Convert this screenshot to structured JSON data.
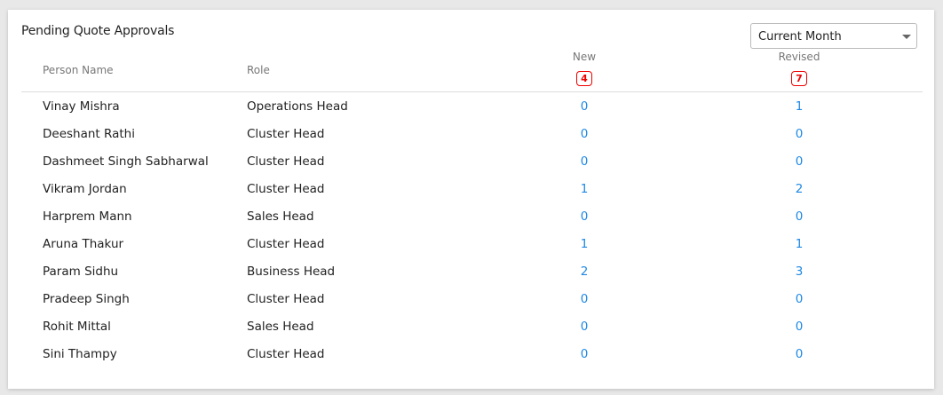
{
  "title": "Pending Quote Approvals",
  "filter": {
    "selected": "Current Month"
  },
  "columns": {
    "person": "Person Name",
    "role": "Role",
    "new": "New",
    "revised": "Revised"
  },
  "totals": {
    "new": "4",
    "revised": "7"
  },
  "colors": {
    "link": "#1e88e5",
    "badge": "#e00000"
  },
  "rows": [
    {
      "name": "Vinay Mishra",
      "role": "Operations Head",
      "new": "0",
      "revised": "1"
    },
    {
      "name": "Deeshant Rathi",
      "role": "Cluster Head",
      "new": "0",
      "revised": "0"
    },
    {
      "name": "Dashmeet Singh Sabharwal",
      "role": "Cluster Head",
      "new": "0",
      "revised": "0"
    },
    {
      "name": "Vikram Jordan",
      "role": "Cluster Head",
      "new": "1",
      "revised": "2"
    },
    {
      "name": "Harprem Mann",
      "role": "Sales Head",
      "new": "0",
      "revised": "0"
    },
    {
      "name": "Aruna Thakur",
      "role": "Cluster Head",
      "new": "1",
      "revised": "1"
    },
    {
      "name": "Param Sidhu",
      "role": "Business Head",
      "new": "2",
      "revised": "3"
    },
    {
      "name": "Pradeep Singh",
      "role": "Cluster Head",
      "new": "0",
      "revised": "0"
    },
    {
      "name": "Rohit Mittal",
      "role": "Sales Head",
      "new": "0",
      "revised": "0"
    },
    {
      "name": "Sini Thampy",
      "role": "Cluster Head",
      "new": "0",
      "revised": "0"
    }
  ]
}
